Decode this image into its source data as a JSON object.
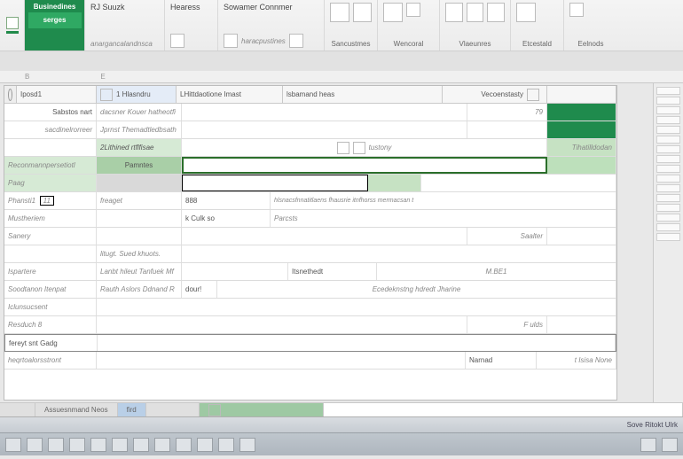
{
  "ribbon": {
    "file_tab": "Businedines",
    "file_sub": "serges",
    "groups": [
      {
        "title": "RJ  Suuzk",
        "sub": "anargancalandnsca"
      },
      {
        "title": "Hearess",
        "sub": ""
      },
      {
        "title": "Sowamer Connmer",
        "sub": "haracpustines"
      },
      {
        "title2": "Sancustmes",
        "caption": ""
      },
      {
        "caption": "Wencoral"
      },
      {
        "caption": "Vlaeunres"
      },
      {
        "caption": "Etcestald"
      },
      {
        "caption": "Eelnods"
      }
    ]
  },
  "namebox": "Iposd1",
  "headers": {
    "a": "",
    "b": "1 Hlasndru",
    "c": "LHittdaotione Imast",
    "d": "lsbamand heas",
    "e": "Vecoenstasty"
  },
  "rows": {
    "r1": {
      "a": "Sabstos nart",
      "b": "dacsner Kouer hatheotfi",
      "r": ""
    },
    "r2": {
      "a": "sacdinelrorreer",
      "b": "Jprnst Themadtledbsath"
    },
    "r3": {
      "b": "2Lithined rtflfisae",
      "mid": "",
      "r": "Tihatilldodan"
    },
    "r4": {
      "a": "Reconmannpersetiotl",
      "b2": "Pamntes"
    },
    "r5": {
      "a": "Paag"
    },
    "r6": {
      "a": "Phansti1",
      "a2": "11",
      "b": "freaget",
      "c": "888",
      "d": "",
      "e": "hlsnacsfnnatitlaens fhausrie itnfhorss mermacsan t"
    },
    "r7": {
      "a": "Mustheriem",
      "c": "k Culk so",
      "e": "Parcsts"
    },
    "r8": {
      "a": "Sanery",
      "e": "Saalter"
    },
    "r9": {
      "a": "",
      "b": "litugt. Sued khuots."
    },
    "r10": {
      "a": "Ispartere",
      "b": "Lanbt hileut Tanfuek Mf",
      "d": "Itsnethedt",
      "e": "M.BE1"
    },
    "r11": {
      "a": "Soodtanon Itenpat",
      "b": "Rauth Aslors Ddnand R",
      "c": "dour!",
      "e": "Ecedeknstng hdredt Jharine"
    },
    "r12": {
      "a": "Iclunsucsent"
    },
    "r13": {
      "a": "Resduch 8",
      "e": "F ulds"
    },
    "r14": {
      "a": "fereyt snt Gadg"
    },
    "r15": {
      "a": "heqrtoalorsstront",
      "d": "Narnad",
      "e": "t Isisa None"
    }
  },
  "sheettabs": {
    "t1": "Assuesnmand Neos",
    "t2": "fird",
    "t3": "",
    "t4": ""
  },
  "status": "Sove Ritokt Ulrk"
}
